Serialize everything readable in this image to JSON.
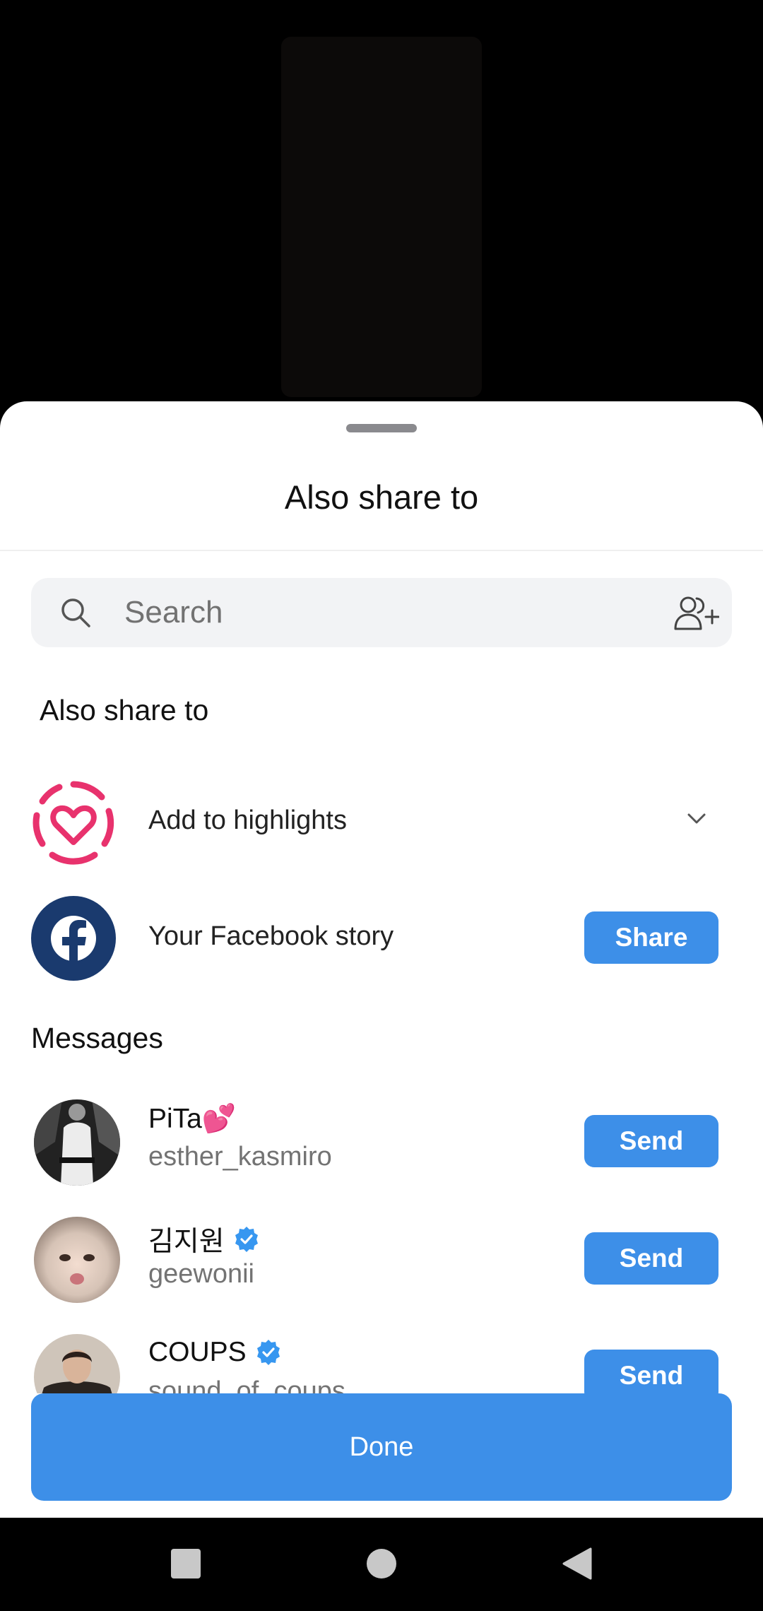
{
  "sheet": {
    "title": "Also share to"
  },
  "search": {
    "placeholder": "Search",
    "value": ""
  },
  "also_share": {
    "heading": "Also share to",
    "highlights_label": "Add to highlights",
    "facebook_label": "Your Facebook story",
    "facebook_button": "Share"
  },
  "messages": {
    "heading": "Messages",
    "contacts": [
      {
        "name": "PiTa💕",
        "handle": "esther_kasmiro",
        "verified": false,
        "button": "Send"
      },
      {
        "name": "김지원",
        "handle": "geewonii",
        "verified": true,
        "button": "Send"
      },
      {
        "name": "COUPS",
        "handle": "sound_of_coups",
        "verified": true,
        "button": "Send"
      }
    ]
  },
  "done_button": "Done",
  "colors": {
    "accent": "#3d8fe8",
    "facebook_navy": "#1a3a6e",
    "highlight_pink": "#e8326d",
    "verified_blue": "#3797f0"
  },
  "icons": [
    "search-icon",
    "add-people-icon",
    "highlights-heart-icon",
    "chevron-down-icon",
    "facebook-icon",
    "verified-icon",
    "nav-square-icon",
    "nav-circle-icon",
    "nav-back-triangle-icon"
  ]
}
